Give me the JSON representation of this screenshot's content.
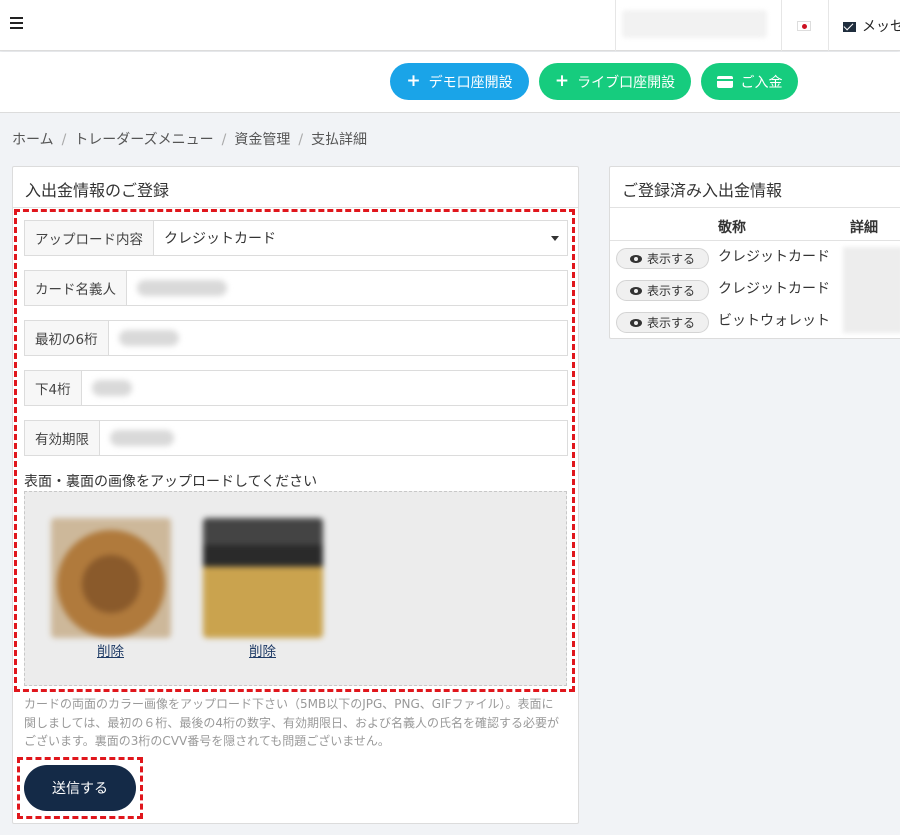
{
  "header": {
    "message_label": "メッセ"
  },
  "actions": {
    "demo_account": "デモ口座開設",
    "live_account": "ライブ口座開設",
    "deposit": "ご入金"
  },
  "breadcrumb": [
    "ホーム",
    "トレーダーズメニュー",
    "資金管理",
    "支払詳細"
  ],
  "form": {
    "title": "入出金情報のご登録",
    "upload_type_label": "アップロード内容",
    "upload_type_value": "クレジットカード",
    "cardholder_label": "カード名義人",
    "first6_label": "最初の6桁",
    "last4_label": "下4桁",
    "expiry_label": "有効期限",
    "upload_instruction": "表面・裏面の画像をアップロードしてください",
    "delete_label": "削除",
    "note": "カードの両面のカラー画像をアップロード下さい（5MB以下のJPG、PNG、GIFファイル）。表面に関しましては、最初の６桁、最後の4桁の数字、有効期限日、および名義人の氏名を確認する必要がございます。裏面の3桁のCVV番号を隠されても問題ございません。",
    "submit_label": "送信する"
  },
  "registered": {
    "title": "ご登録済み入出金情報",
    "columns": [
      "敬称",
      "詳細"
    ],
    "show_label": "表示する",
    "rows": [
      {
        "name": "クレジットカード"
      },
      {
        "name": "クレジットカード"
      },
      {
        "name": "ビットウォレット"
      }
    ]
  },
  "colors": {
    "accent_blue": "#1aa4e8",
    "accent_green": "#16cc7e",
    "submit_navy": "#142a47",
    "highlight_red": "#e0161c"
  },
  "icons": [
    "hamburger-icon",
    "flag-icon",
    "envelope-icon",
    "plus-icon",
    "card-icon",
    "eye-icon",
    "caret-down-icon"
  ]
}
